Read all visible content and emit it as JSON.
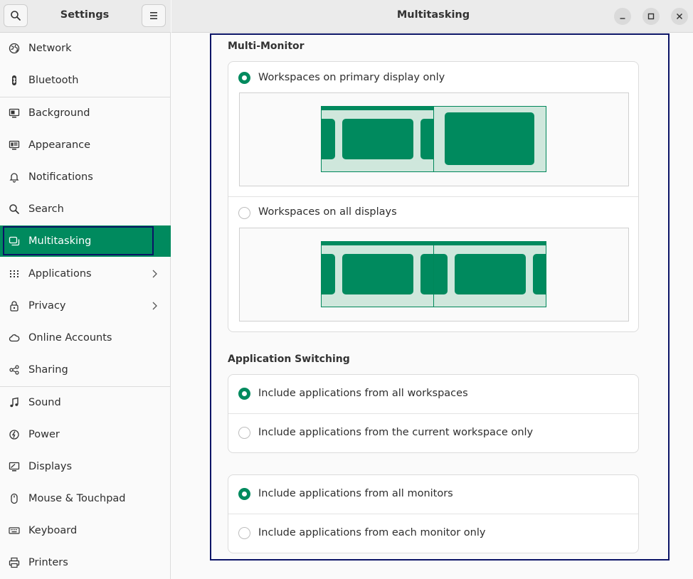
{
  "sidebar": {
    "title": "Settings",
    "search_icon": "search-icon",
    "menu_icon": "hamburger-menu-icon",
    "items": [
      {
        "label": "Network",
        "icon": "globe-icon"
      },
      {
        "label": "Bluetooth",
        "icon": "bluetooth-icon"
      },
      {
        "label": "Background",
        "icon": "monitor-icon"
      },
      {
        "label": "Appearance",
        "icon": "appearance-icon"
      },
      {
        "label": "Notifications",
        "icon": "bell-icon"
      },
      {
        "label": "Search",
        "icon": "search-icon"
      },
      {
        "label": "Multitasking",
        "icon": "multitasking-icon",
        "active": true
      },
      {
        "label": "Applications",
        "icon": "apps-grid-icon",
        "has_submenu": true
      },
      {
        "label": "Privacy",
        "icon": "lock-icon",
        "has_submenu": true
      },
      {
        "label": "Online Accounts",
        "icon": "cloud-icon"
      },
      {
        "label": "Sharing",
        "icon": "share-icon"
      },
      {
        "label": "Sound",
        "icon": "music-note-icon"
      },
      {
        "label": "Power",
        "icon": "power-icon"
      },
      {
        "label": "Displays",
        "icon": "display-icon"
      },
      {
        "label": "Mouse & Touchpad",
        "icon": "mouse-icon"
      },
      {
        "label": "Keyboard",
        "icon": "keyboard-icon"
      },
      {
        "label": "Printers",
        "icon": "printer-icon"
      }
    ]
  },
  "window": {
    "title": "Multitasking",
    "minimize_icon": "minimize-icon",
    "maximize_icon": "maximize-icon",
    "close_icon": "close-icon"
  },
  "multi_monitor": {
    "title": "Multi-Monitor",
    "options": [
      {
        "label": "Workspaces on primary display only",
        "selected": true
      },
      {
        "label": "Workspaces on all displays",
        "selected": false
      }
    ]
  },
  "application_switching": {
    "title": "Application Switching",
    "workspace_options": [
      {
        "label": "Include applications from all workspaces",
        "selected": true
      },
      {
        "label": "Include applications from the current workspace only",
        "selected": false
      }
    ],
    "monitor_options": [
      {
        "label": "Include applications from all monitors",
        "selected": true
      },
      {
        "label": "Include applications from each monitor only",
        "selected": false
      }
    ]
  },
  "colors": {
    "accent": "#008a5e",
    "accent_light": "#cfe7dc",
    "focus_ring": "#0b1466"
  }
}
